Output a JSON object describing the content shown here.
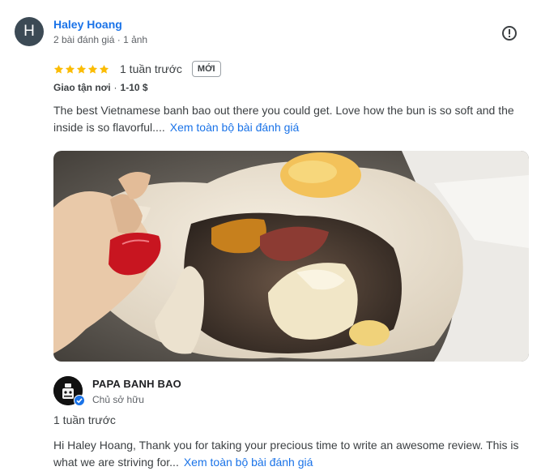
{
  "reviewer": {
    "avatar_initial": "H",
    "name": "Haley Hoang",
    "meta": "2 bài đánh giá · 1 ảnh"
  },
  "review": {
    "rating": 5,
    "star_color": "#fbbc04",
    "time": "1 tuần trước",
    "badge": "MỚI",
    "service": "Giao tận nơi",
    "price": "1-10 $",
    "text": "The best Vietnamese banh bao out there you could get. Love how the bun is so soft and the inside is so flavorful....",
    "more_label": "Xem toàn bộ bài đánh giá",
    "report_icon": "report-flag-icon"
  },
  "owner_reply": {
    "name": "PAPA BANH BAO",
    "role": "Chủ sở hữu",
    "verified_color": "#1a73e8",
    "time": "1 tuần trước",
    "text": "Hi Haley Hoang, Thank you for taking your precious time to write an awesome review. This is what we are striving for...",
    "more_label": "Xem toàn bộ bài đánh giá"
  }
}
